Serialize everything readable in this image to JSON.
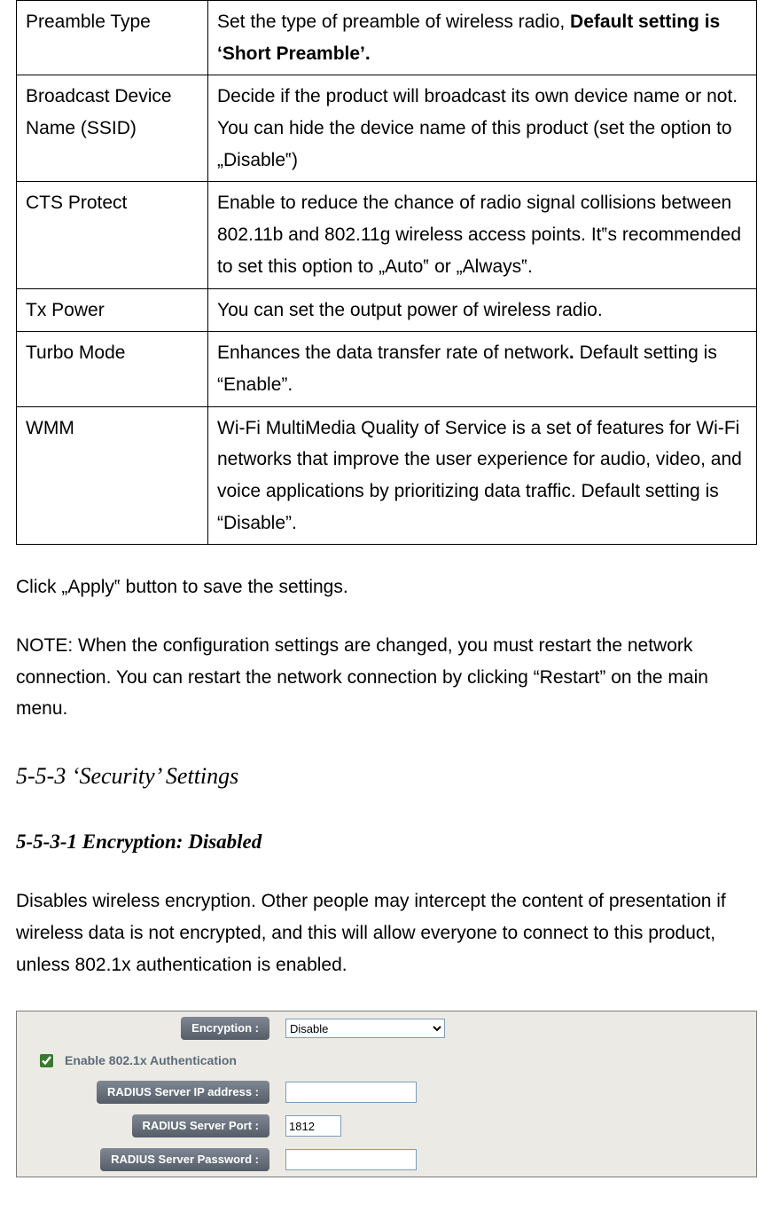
{
  "table": {
    "rows": [
      {
        "k": "Preamble Type",
        "v_pre": "Set the type of preamble of wireless radio, ",
        "v_bold": "Default setting is ‘Short Preamble’."
      },
      {
        "k": "Broadcast Device Name (SSID)",
        "v": "Decide if the product will broadcast its own device name or not. You can hide the device name of this product (set the option to „Disable‟)"
      },
      {
        "k": "CTS Protect",
        "v": "Enable to reduce the chance of radio signal collisions between 802.11b and 802.11g wireless access points. It‟s recommended to set this option to „Auto‟ or „Always‟."
      },
      {
        "k": "Tx Power",
        "v": "You can set the output power of wireless radio."
      },
      {
        "k": "Turbo Mode",
        "v_pre": "Enhances the data transfer rate of network",
        ". ": ". ",
        "v_bold_dot": ".",
        "v_after": " Default setting is “Enable”."
      },
      {
        "k": "WMM",
        "v": "Wi-Fi MultiMedia Quality of Service is a set of features for Wi-Fi networks that improve the user experience for audio, video, and voice applications by prioritizing data traffic. Default setting is “Disable”."
      }
    ]
  },
  "para_apply": "Click „Apply‟ button to save the settings.",
  "para_note": "NOTE: When the configuration settings are changed, you must restart the network connection. You can restart the network connection by clicking “Restart” on the main menu.",
  "h553": "5-5-3 ‘Security’ Settings",
  "h5531": "5-5-3-1 Encryption: Disabled",
  "para_enc": "Disables wireless encryption. Other people may intercept the content of presentation if wireless data is not encrypted, and this will allow everyone to connect to this product, unless 802.1x authentication is enabled.",
  "shot": {
    "encryption_label": "Encryption :",
    "encryption_value": "Disable",
    "auth_label": "Enable 802.1x Authentication",
    "auth_checked": true,
    "ip_label": "RADIUS Server IP address :",
    "ip_value": "",
    "port_label": "RADIUS Server Port :",
    "port_value": "1812",
    "pwd_label": "RADIUS Server Password :",
    "pwd_value": ""
  }
}
